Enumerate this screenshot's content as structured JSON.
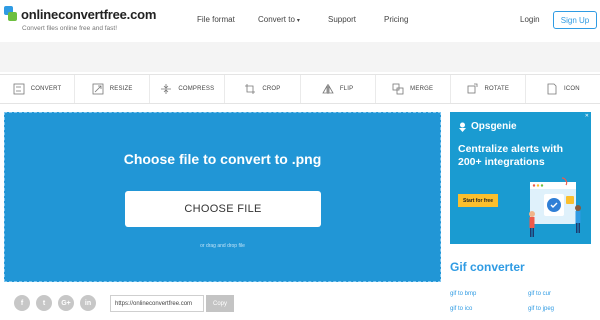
{
  "header": {
    "logo_title": "onlineconvertfree.com",
    "logo_subtitle": "Convert files online free and fast!",
    "nav": [
      {
        "label": "File format"
      },
      {
        "label": "Convert to"
      },
      {
        "label": "Support"
      },
      {
        "label": "Pricing"
      }
    ],
    "login": "Login",
    "signup": "Sign Up"
  },
  "toolbar": {
    "tools": [
      {
        "label": "CONVERT",
        "icon": "convert-icon"
      },
      {
        "label": "RESIZE",
        "icon": "resize-icon"
      },
      {
        "label": "COMPRESS",
        "icon": "compress-icon"
      },
      {
        "label": "CROP",
        "icon": "crop-icon"
      },
      {
        "label": "FLIP",
        "icon": "flip-icon"
      },
      {
        "label": "MERGE",
        "icon": "merge-icon"
      },
      {
        "label": "ROTATE",
        "icon": "rotate-icon"
      },
      {
        "label": "ICON",
        "icon": "icon-icon"
      }
    ]
  },
  "upload": {
    "title": "Choose file to convert to .png",
    "button": "CHOOSE FILE",
    "hint": "or drag and drop file",
    "bg_color": "#2196d6"
  },
  "ad": {
    "brand": "Opsgenie",
    "headline": "Centralize alerts with 200+ integrations",
    "cta": "Start for free"
  },
  "gif_converter": {
    "title": "Gif converter",
    "links": [
      "gif to bmp",
      "gif to cur",
      "gif to ico",
      "gif to jpeg"
    ]
  },
  "share": {
    "url": "https://onlineconvertfree.com",
    "copy": "Copy",
    "socials": [
      "f",
      "t",
      "G+",
      "in"
    ]
  },
  "colors": {
    "accent": "#2f9be3",
    "ad_bg": "#1a9bd1",
    "cta": "#fbbf2d"
  }
}
